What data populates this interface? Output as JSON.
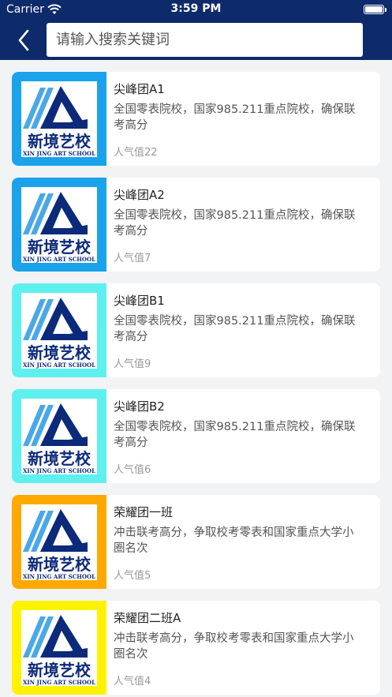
{
  "status_bar": {
    "carrier": "Carrier",
    "time": "3:59 PM"
  },
  "header": {
    "back_icon": "chevron-left-icon",
    "search_placeholder": "请输入搜索关键词",
    "background_color": "#0d2a6a"
  },
  "logo": {
    "chinese": "新境艺校",
    "english": "XIN JING ART SCHOOL"
  },
  "items": [
    {
      "title": "尖峰团A1",
      "desc": "全国零表院校，国家985.211重点院校，确保联考高分",
      "popularity": "人气值22",
      "thumb_color": "#1aa3ea"
    },
    {
      "title": "尖峰团A2",
      "desc": "全国零表院校，国家985.211重点院校，确保联考高分",
      "popularity": "人气值7",
      "thumb_color": "#1aa3ea"
    },
    {
      "title": "尖峰团B1",
      "desc": "全国零表院校，国家985.211重点院校，确保联考高分",
      "popularity": "人气值9",
      "thumb_color": "#5ef0ee"
    },
    {
      "title": "尖峰团B2",
      "desc": "全国零表院校，国家985.211重点院校，确保联考高分",
      "popularity": "人气值6",
      "thumb_color": "#5ef0ee"
    },
    {
      "title": "荣耀团一班",
      "desc": "冲击联考高分，争取校考零表和国家重点大学小圈名次",
      "popularity": "人气值5",
      "thumb_color": "#ffa800"
    },
    {
      "title": "荣耀团二班A",
      "desc": "冲击联考高分，争取校考零表和国家重点大学小圈名次",
      "popularity": "人气值4",
      "thumb_color": "#fff200"
    }
  ]
}
